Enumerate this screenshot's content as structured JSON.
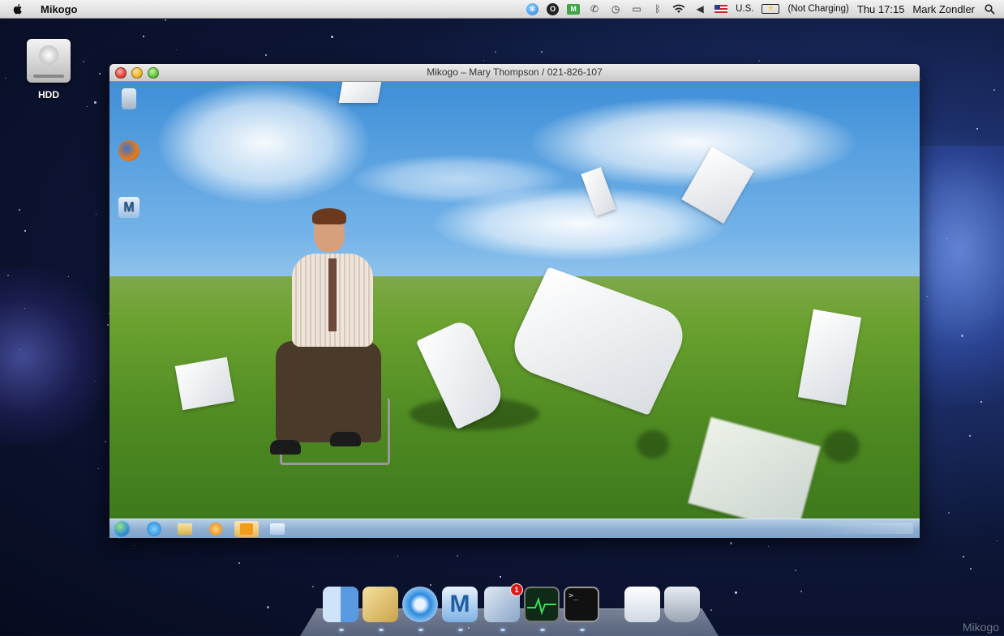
{
  "menubar": {
    "app_name": "Mikogo",
    "input_source": "U.S.",
    "battery_status": "(Not Charging)",
    "clock": "Thu 17:15",
    "user": "Mark Zondler",
    "status_icons": [
      "connectivity-icon",
      "mikogo-status-icon",
      "green-app-icon",
      "phone-icon",
      "time-machine-icon",
      "display-icon",
      "bluetooth-icon",
      "wifi-icon",
      "volume-icon",
      "flag-icon",
      "battery-icon",
      "spotlight-icon"
    ]
  },
  "desktop": {
    "hdd_label": "HDD"
  },
  "window": {
    "title": "Mikogo – Mary Thompson / 021-826-107"
  },
  "dock": {
    "apps": [
      "finder",
      "preview",
      "safari",
      "mikogo",
      "mail",
      "activity-monitor",
      "terminal",
      "documents",
      "trash"
    ],
    "mail_badge": "1"
  },
  "watermark": "Mikogo",
  "colors": {
    "menubar_bg": "#dcdcdc",
    "sky_top": "#3f8fd8",
    "grass": "#5a9428",
    "taskbar": "#9fbcdc"
  }
}
